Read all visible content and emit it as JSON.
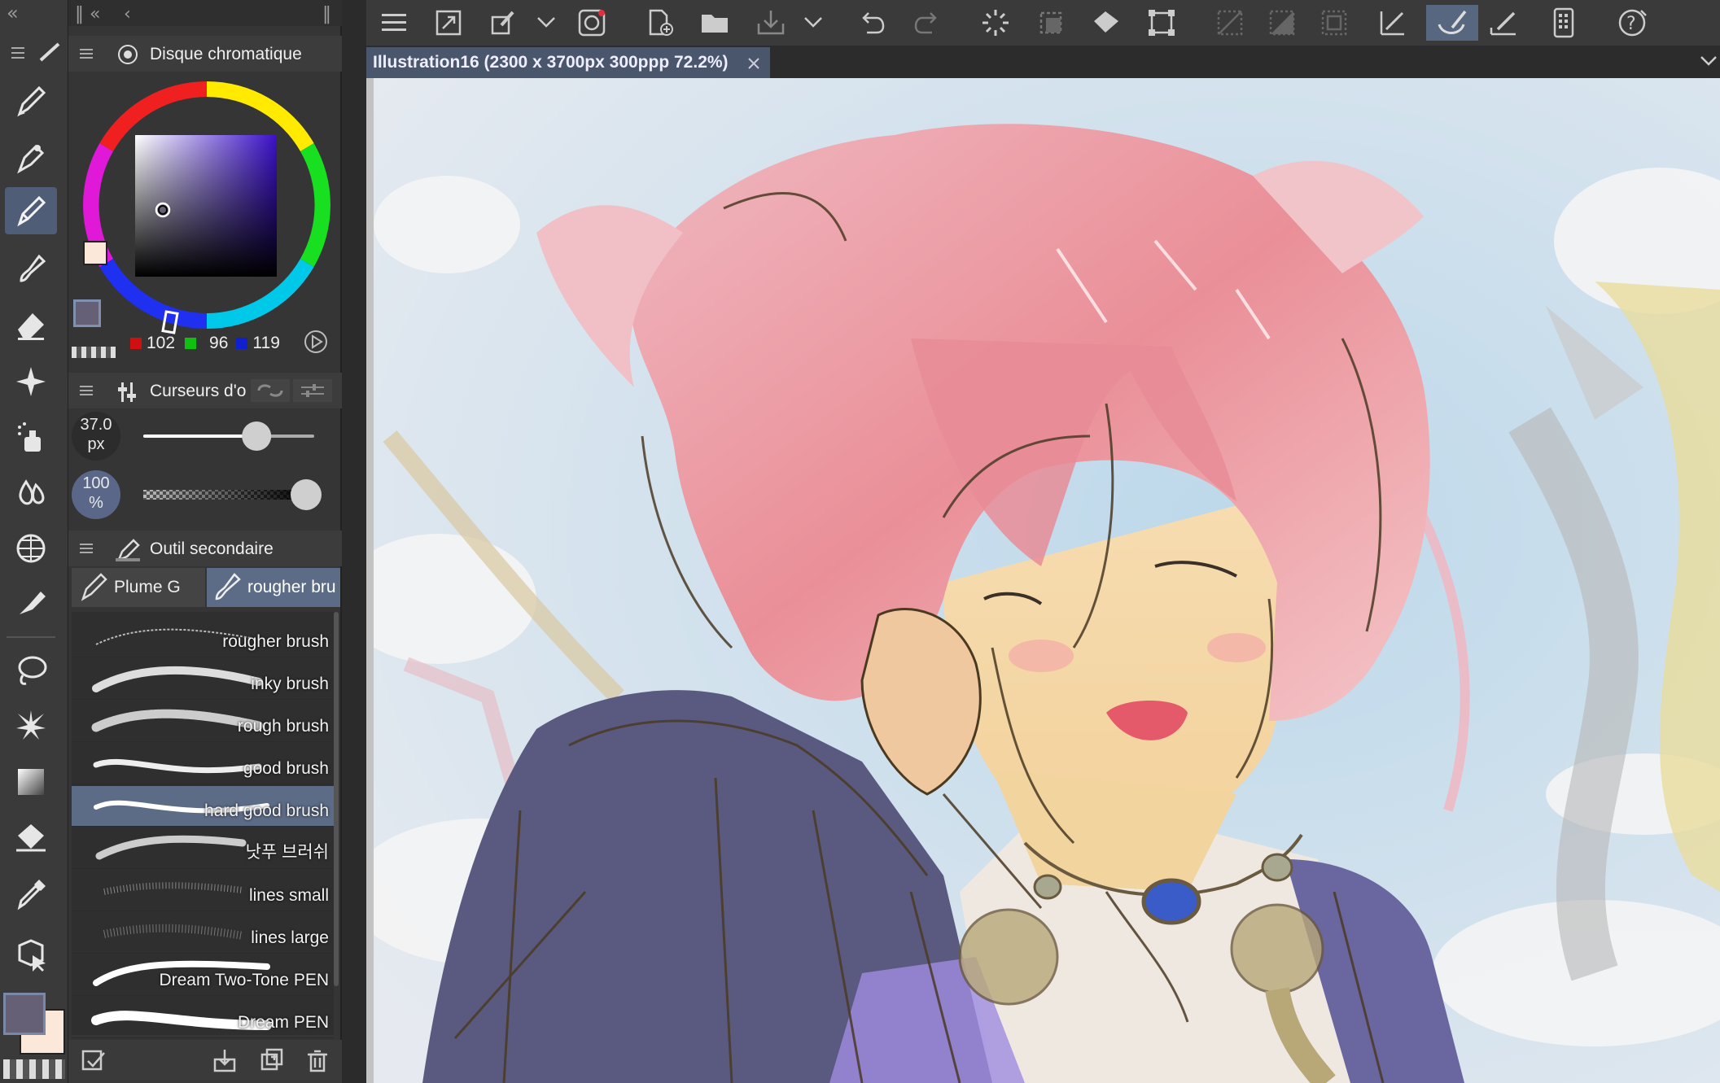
{
  "app": {
    "document_tab": "Illustration16 (2300 x 3700px 300ppp 72.2%)"
  },
  "color_wheel": {
    "title": "Disque chromatique",
    "rgb": {
      "r": "102",
      "g": "96",
      "b": "119"
    },
    "main_color": "#666077",
    "sub_color": "#fbe8d8"
  },
  "sliders": {
    "title": "Curseurs d'o",
    "size_value": "37.0",
    "size_unit": "px",
    "size_level": 0.68,
    "opacity_value": "100",
    "opacity_unit": "%",
    "opacity_level": 1.0
  },
  "sub_tool": {
    "title": "Outil secondaire",
    "groups": [
      {
        "label": "Plume G"
      },
      {
        "label": "rougher bru"
      }
    ],
    "brushes": [
      {
        "label": "rougher brush"
      },
      {
        "label": "inky brush"
      },
      {
        "label": "rough brush"
      },
      {
        "label": "good brush"
      },
      {
        "label": "hard good brush"
      },
      {
        "label": "낫푸 브러쉬"
      },
      {
        "label": "lines small"
      },
      {
        "label": "lines large"
      },
      {
        "label": "Dream Two-Tone PEN"
      },
      {
        "label": "Dream PEN"
      }
    ],
    "active_index": 4
  },
  "tools": [
    "pen-icon",
    "pen-nib-icon",
    "pencil-icon",
    "brush-icon",
    "eraser-icon",
    "sparkle-icon",
    "airbrush-icon",
    "blend-icon",
    "grid-icon",
    "ink-icon",
    "lasso-icon",
    "auto-select-icon",
    "gradient-icon",
    "fill-icon",
    "eyedropper-icon",
    "move-icon"
  ],
  "colors": {
    "accent": "#586780",
    "panel": "#353535",
    "toolbar": "#3a3a3a"
  }
}
